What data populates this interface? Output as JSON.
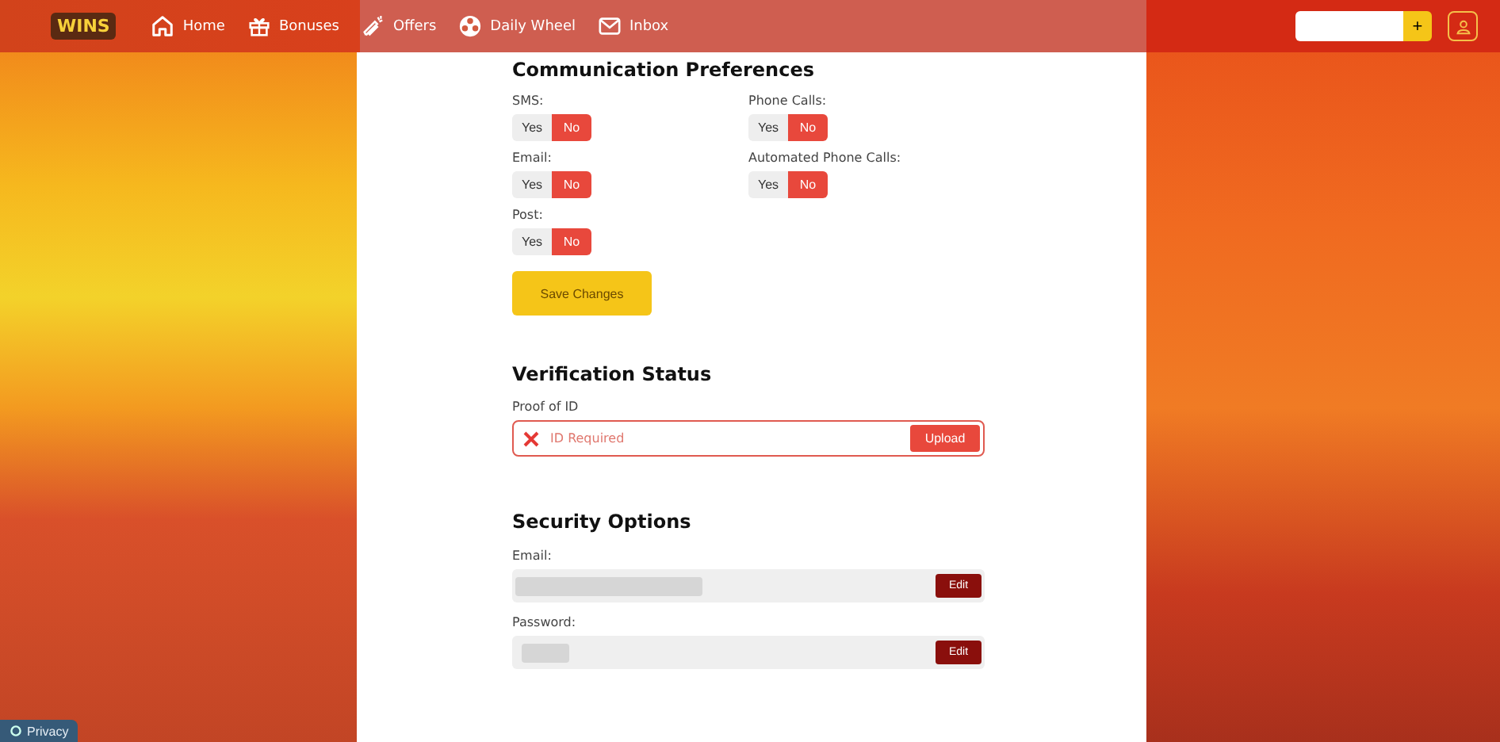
{
  "header": {
    "logo_text": "WINS",
    "nav": [
      {
        "label": "Home",
        "kind": "home"
      },
      {
        "label": "Bonuses",
        "kind": "gift"
      },
      {
        "label": "Offers",
        "kind": "fire"
      },
      {
        "label": "Daily Wheel",
        "kind": "wheel"
      },
      {
        "label": "Inbox",
        "kind": "mail"
      }
    ],
    "add_button": "+"
  },
  "communication": {
    "title": "Communication Preferences",
    "preferences": [
      {
        "label": "SMS:",
        "options": [
          {
            "label": "Yes",
            "selected": false
          },
          {
            "label": "No",
            "selected": true
          }
        ]
      },
      {
        "label": "Phone Calls:",
        "options": [
          {
            "label": "Yes",
            "selected": false
          },
          {
            "label": "No",
            "selected": true
          }
        ]
      },
      {
        "label": "Email:",
        "options": [
          {
            "label": "Yes",
            "selected": false
          },
          {
            "label": "No",
            "selected": true
          }
        ]
      },
      {
        "label": "Automated Phone Calls:",
        "options": [
          {
            "label": "Yes",
            "selected": false
          },
          {
            "label": "No",
            "selected": true
          }
        ]
      },
      {
        "label": "Post:",
        "options": [
          {
            "label": "Yes",
            "selected": false
          },
          {
            "label": "No",
            "selected": true
          }
        ]
      }
    ],
    "save_button": "Save Changes"
  },
  "verification": {
    "title": "Verification Status",
    "label": "Proof of ID",
    "status": "ID Required",
    "button": "Upload"
  },
  "security": {
    "title": "Security Options",
    "fields": [
      {
        "label": "Email:",
        "button": "Edit"
      },
      {
        "label": "Password:",
        "button": "Edit"
      }
    ]
  },
  "privacy_button": "Privacy"
}
